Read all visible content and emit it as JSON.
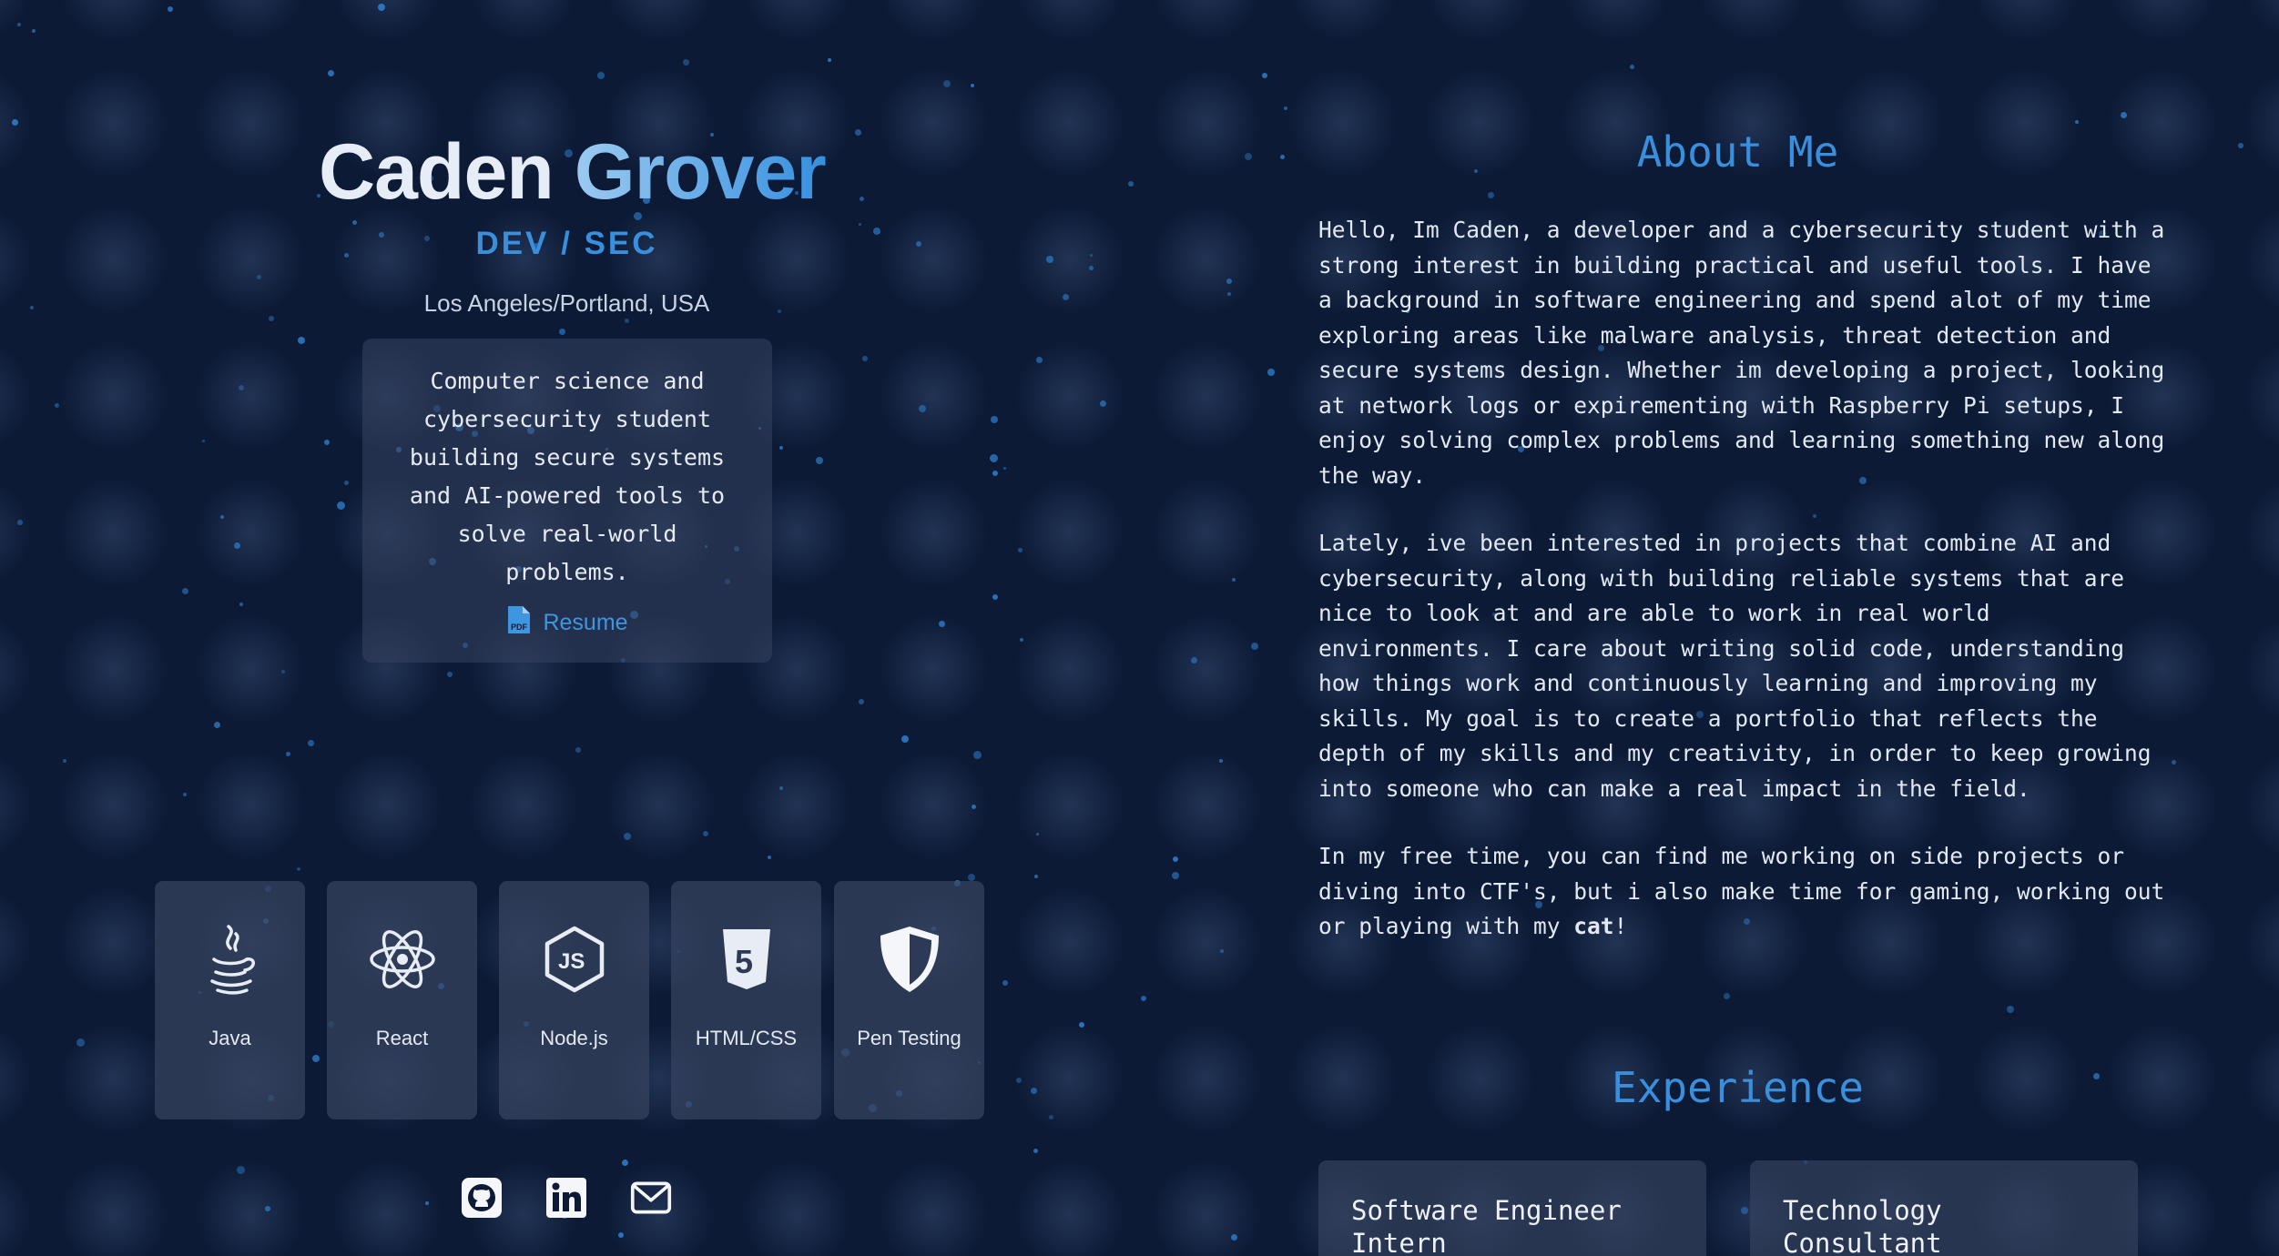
{
  "profile": {
    "first_name": "Caden",
    "last_name": "Grover",
    "role": "DEV / SEC",
    "location": "Los Angeles/Portland, USA",
    "intro": "Computer science and cybersecurity student building secure systems and AI-powered tools to solve real-world problems.",
    "resume_label": "Resume",
    "resume_icon": "pdf-file-icon"
  },
  "skills": [
    {
      "label": "Java",
      "icon": "java-icon"
    },
    {
      "label": "React",
      "icon": "react-icon"
    },
    {
      "label": "Node.js",
      "icon": "nodejs-icon"
    },
    {
      "label": "HTML/CSS",
      "icon": "html5-icon"
    },
    {
      "label": "Pen Testing",
      "icon": "shield-icon"
    }
  ],
  "socials": [
    {
      "name": "github",
      "icon": "github-icon"
    },
    {
      "name": "linkedin",
      "icon": "linkedin-icon"
    },
    {
      "name": "email",
      "icon": "envelope-icon"
    }
  ],
  "about": {
    "title": "About Me",
    "p1": "Hello, Im Caden, a developer and a cybersecurity student with a strong interest in building practical and useful tools. I have a background in software engineering and spend alot of my time exploring areas like malware analysis, threat detection and secure systems design. Whether im developing a project, looking at network logs or expirementing with Raspberry Pi setups, I enjoy solving complex problems and learning something new along the way.",
    "p2": "Lately, ive been interested in projects that combine AI and cybersecurity, along with building reliable systems that are nice to look at and are able to work in real world environments. I care about writing solid code, understanding how things work and continuously learning and improving my skills. My goal is to create a portfolio that reflects the depth of my skills and my creativity, in order to keep growing into someone who can make a real impact in the field.",
    "p3_before": "In my free time, you can find me working on side projects or diving into CTF's, but i also make time for gaming, working out or playing with my ",
    "p3_bold": "cat",
    "p3_after": "!"
  },
  "experience": {
    "title": "Experience",
    "items": [
      {
        "title": "Software Engineer Intern"
      },
      {
        "title": "Technology Consultant"
      }
    ]
  },
  "colors": {
    "background": "#0c1a35",
    "accent": "#3a8fdc",
    "card": "#2a3652",
    "text": "#e3e9f3"
  }
}
